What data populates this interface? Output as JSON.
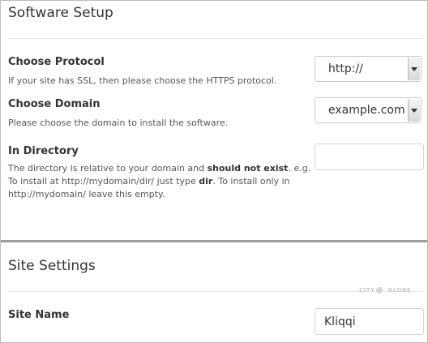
{
  "software_setup": {
    "title": "Software Setup",
    "protocol": {
      "label": "Choose Protocol",
      "help": "If your site has SSL, then please choose the HTTPS protocol.",
      "selected": "http://"
    },
    "domain": {
      "label": "Choose Domain",
      "help": "Please choose the domain to install the software.",
      "selected": "example.com"
    },
    "directory": {
      "label": "In Directory",
      "help_part1": "The directory is relative to your domain and ",
      "help_bold1": "should not exist",
      "help_part2": ". e.g. To install at http://mydomain/dir/ just type ",
      "help_bold2": "dir",
      "help_part3": ". To install only in http://mydomain/ leave this empty.",
      "value": ""
    }
  },
  "site_settings": {
    "title": "Site Settings",
    "site_name": {
      "label": "Site Name",
      "value": "Kliqqi"
    }
  },
  "watermark": {
    "left": "CITY",
    "right": "GLOBE"
  }
}
